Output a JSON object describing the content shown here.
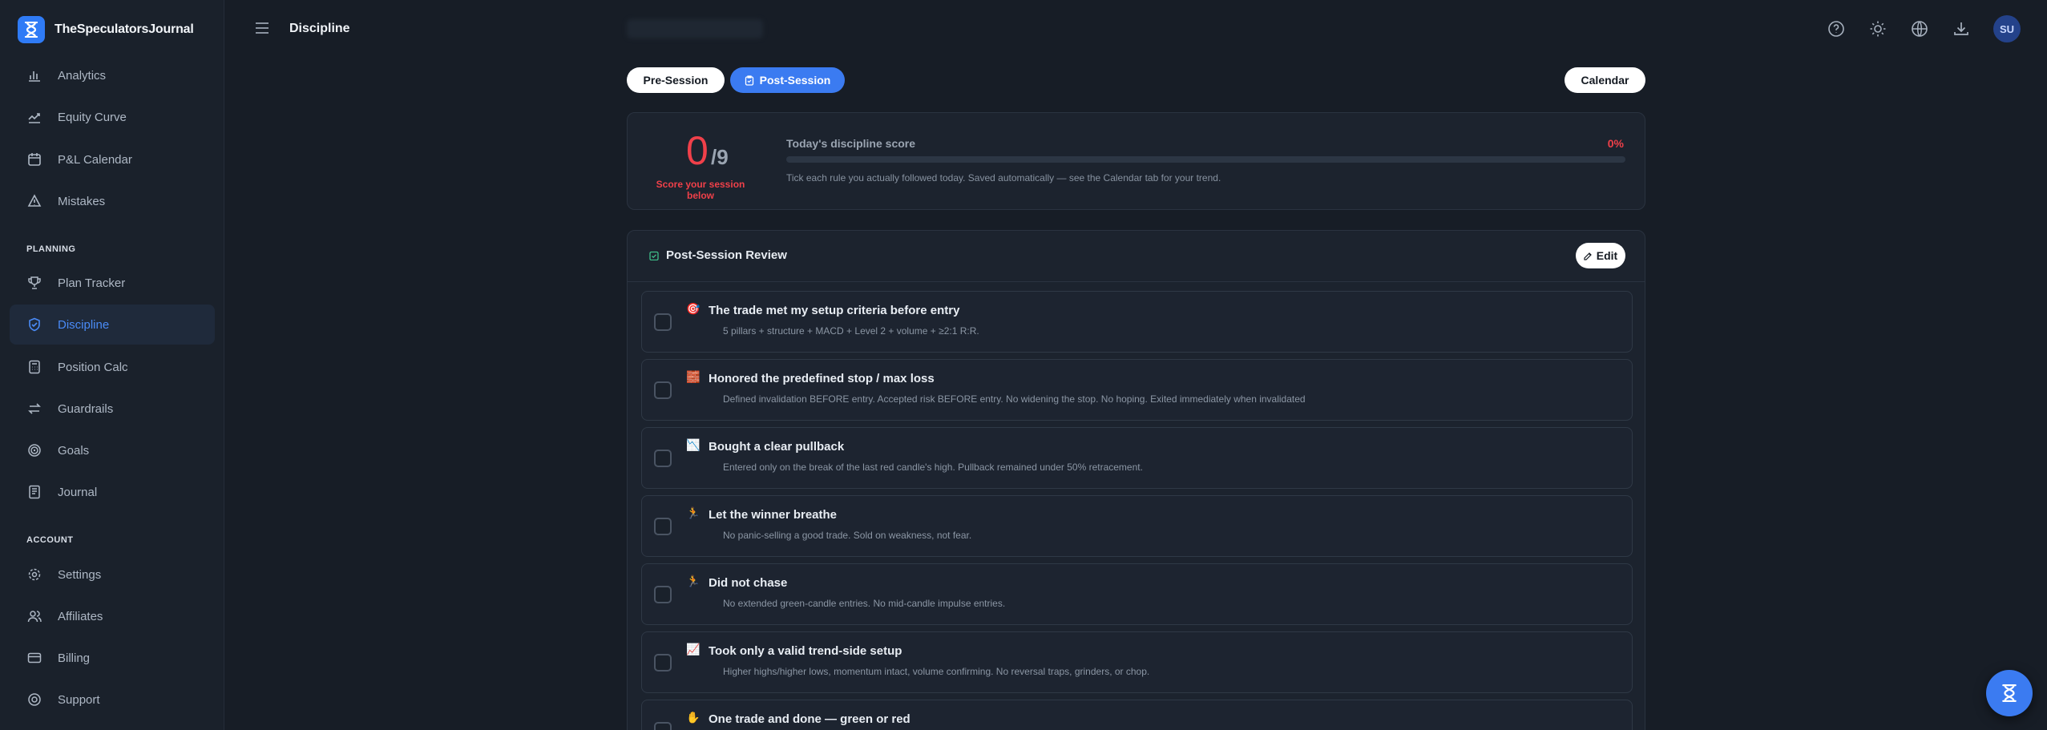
{
  "app": {
    "name": "TheSpeculatorsJournal",
    "brand_color": "#2f7bf6"
  },
  "sidebar": {
    "items": [
      {
        "label": "Analytics",
        "icon": "bar-chart-icon"
      },
      {
        "label": "Equity Curve",
        "icon": "trend-icon"
      },
      {
        "label": "P&L Calendar",
        "icon": "calendar-icon"
      },
      {
        "label": "Mistakes",
        "icon": "warning-icon"
      }
    ],
    "planning_label": "PLANNING",
    "planning_items": [
      {
        "label": "Plan Tracker",
        "icon": "trophy-icon"
      },
      {
        "label": "Discipline",
        "icon": "shield-icon",
        "active": true
      },
      {
        "label": "Position Calc",
        "icon": "calculator-icon"
      },
      {
        "label": "Guardrails",
        "icon": "arrows-icon"
      },
      {
        "label": "Goals",
        "icon": "target-icon"
      },
      {
        "label": "Journal",
        "icon": "book-icon"
      }
    ],
    "account_label": "ACCOUNT",
    "account_items": [
      {
        "label": "Settings",
        "icon": "gear-icon"
      },
      {
        "label": "Affiliates",
        "icon": "users-icon"
      },
      {
        "label": "Billing",
        "icon": "card-icon"
      },
      {
        "label": "Support",
        "icon": "lifebuoy-icon"
      }
    ]
  },
  "header": {
    "title": "Discipline",
    "avatar_initials": "SU",
    "icons": [
      "help-icon",
      "sun-icon",
      "globe-icon",
      "download-icon"
    ]
  },
  "tabs": {
    "pre": "Pre-Session",
    "post": "Post-Session",
    "calendar": "Calendar"
  },
  "score": {
    "value": "0",
    "total": "/9",
    "hint": "Score your session below",
    "label": "Today's discipline score",
    "percent": "0%",
    "progress_fraction": 0,
    "description": "Tick each rule you actually followed today. Saved automatically — see the Calendar tab for your trend."
  },
  "review": {
    "title": "Post-Session Review",
    "edit_label": "Edit",
    "rules": [
      {
        "emoji": "🎯",
        "title": "The trade met my setup criteria before entry",
        "desc": "5 pillars + structure + MACD + Level 2 + volume + ≥2:1 R:R."
      },
      {
        "emoji": "🧱",
        "title": "Honored the predefined stop / max loss",
        "desc": "Defined invalidation BEFORE entry. Accepted risk BEFORE entry. No widening the stop. No hoping. Exited immediately when invalidated"
      },
      {
        "emoji": "📉",
        "title": "Bought a clear pullback",
        "desc": "Entered only on the break of the last red candle's high. Pullback remained under 50% retracement."
      },
      {
        "emoji": "🏃",
        "title": "Let the winner breathe",
        "desc": "No panic-selling a good trade. Sold on weakness, not fear."
      },
      {
        "emoji": "🏃",
        "title": "Did not chase",
        "desc": "No extended green-candle entries. No mid-candle impulse entries."
      },
      {
        "emoji": "📈",
        "title": "Took only a valid trend-side setup",
        "desc": "Higher highs/higher lows, momentum intact, volume confirming. No reversal traps, grinders, or chop."
      },
      {
        "emoji": "✋",
        "title": "One trade and done — green or red",
        "desc": ""
      }
    ]
  },
  "colors": {
    "accent": "#3b7bf1",
    "danger": "#ef4049",
    "background": "#171d26"
  }
}
